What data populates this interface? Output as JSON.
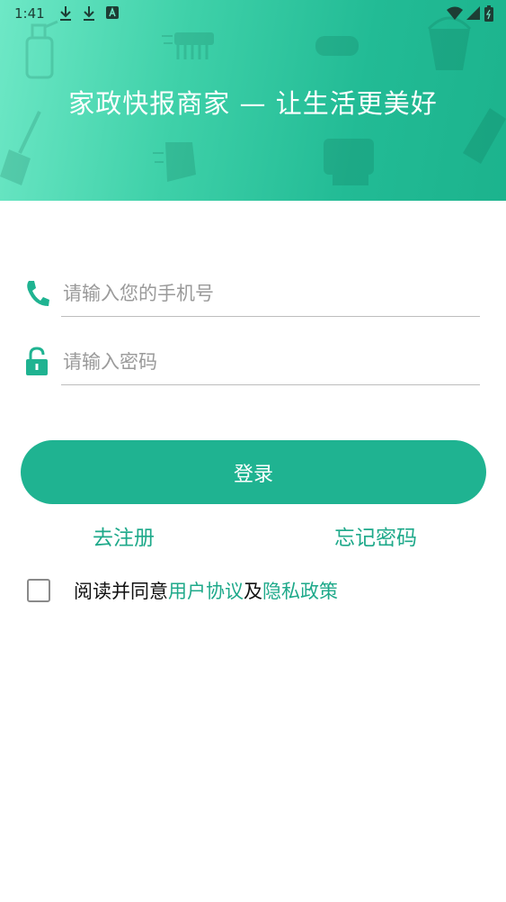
{
  "status_bar": {
    "time": "1:41",
    "left_icons": [
      "download-icon",
      "download-icon",
      "a-box-icon"
    ],
    "right_icons": [
      "wifi-icon",
      "signal-icon",
      "battery-icon"
    ]
  },
  "header": {
    "title": "家政快报商家 — 让生活更美好",
    "gradient_start": "#6ee8c6",
    "gradient_end": "#1cb38d"
  },
  "form": {
    "phone": {
      "icon": "phone-icon",
      "placeholder": "请输入您的手机号",
      "value": ""
    },
    "password": {
      "icon": "lock-icon",
      "placeholder": "请输入密码",
      "value": ""
    }
  },
  "login_button": {
    "label": "登录",
    "color": "#1fb391"
  },
  "links": {
    "register": "去注册",
    "forgot_password": "忘记密码"
  },
  "agreement": {
    "checked": false,
    "prefix": "阅读并同意",
    "user_agreement": "用户协议",
    "conjunction": "及",
    "privacy_policy": "隐私政策"
  },
  "colors": {
    "accent": "#1ea98a"
  }
}
